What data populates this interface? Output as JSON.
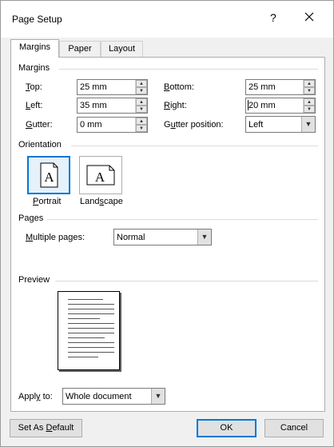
{
  "window": {
    "title": "Page Setup",
    "help_glyph": "?",
    "close_icon": "close-icon"
  },
  "tabs": [
    {
      "label": "Margins",
      "active": true
    },
    {
      "label": "Paper",
      "active": false
    },
    {
      "label": "Layout",
      "active": false
    }
  ],
  "margins": {
    "group_label": "Margins",
    "top": {
      "label_u": "T",
      "label_rest": "op:",
      "value": "25 mm"
    },
    "bottom": {
      "label_u": "B",
      "label_rest": "ottom:",
      "value": "25 mm"
    },
    "left": {
      "label_u": "L",
      "label_rest": "eft:",
      "value": "35 mm"
    },
    "right": {
      "label_u": "R",
      "label_rest": "ight:",
      "value": "20 mm"
    },
    "gutter": {
      "label_pre": "",
      "label_u": "G",
      "label_rest": "utter:",
      "value": "0 mm"
    },
    "gutter_position": {
      "label_pre": "G",
      "label_u": "u",
      "label_rest": "tter position:",
      "value": "Left"
    }
  },
  "orientation": {
    "group_label": "Orientation",
    "portrait": {
      "label_u": "P",
      "label_rest": "ortrait",
      "glyph": "A",
      "selected": true
    },
    "landscape": {
      "label_pre": "Land",
      "label_u": "s",
      "label_rest": "cape",
      "glyph": "A",
      "selected": false
    }
  },
  "pages": {
    "group_label": "Pages",
    "multiple_label_u": "M",
    "multiple_label_rest": "ultiple pages:",
    "multiple_value": "Normal"
  },
  "preview": {
    "group_label": "Preview"
  },
  "apply": {
    "label_pre": "Appl",
    "label_u": "y",
    "label_rest": " to:",
    "value": "Whole document"
  },
  "buttons": {
    "set_default_pre": "Set As ",
    "set_default_u": "D",
    "set_default_rest": "efault",
    "ok": "OK",
    "cancel": "Cancel"
  }
}
